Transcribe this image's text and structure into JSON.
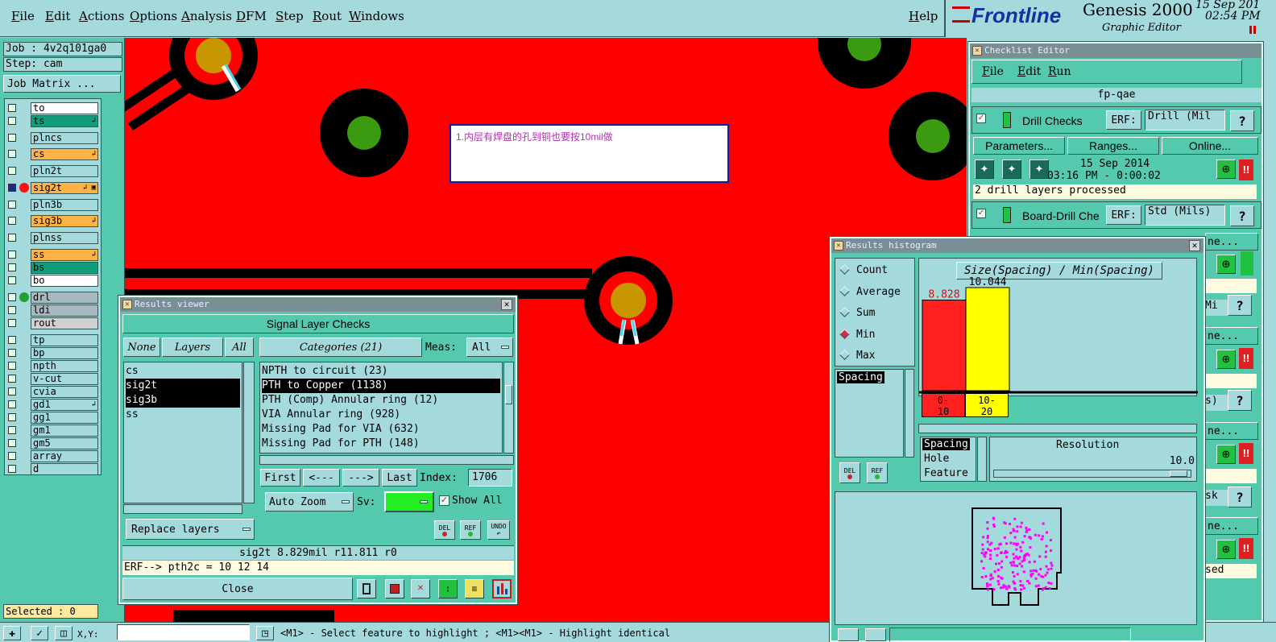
{
  "menu": {
    "items": [
      "File",
      "Edit",
      "Actions",
      "Options",
      "Analysis",
      "DFM",
      "Step",
      "Rout",
      "Windows"
    ],
    "help": "Help",
    "brand": "Frontline",
    "product": "Genesis 2000",
    "subtitle": "Graphic Editor",
    "date": "15 Sep 201",
    "time": "02:54 PM"
  },
  "left": {
    "job": "Job : 4v2q101ga0",
    "step": "Step: cam",
    "job_matrix": "Job Matrix ...",
    "selected": "Selected : 0",
    "xy_label": "X,Y:"
  },
  "layers": [
    {
      "name": "to",
      "color": "#ffffff",
      "flag": ""
    },
    {
      "name": "ts",
      "color": "#119c7b",
      "flag": "↲"
    },
    {
      "name": "plncs",
      "color": "#a4dadb",
      "flag": ""
    },
    {
      "name": "cs",
      "color": "#ffb347",
      "flag": "↲"
    },
    {
      "name": "pln2t",
      "color": "#a4dadb",
      "flag": ""
    },
    {
      "name": "sig2t",
      "color": "#ffb347",
      "flag": "↲ ▣"
    },
    {
      "name": "pln3b",
      "color": "#a4dadb",
      "flag": ""
    },
    {
      "name": "sig3b",
      "color": "#ffb347",
      "flag": "↲"
    },
    {
      "name": "plnss",
      "color": "#a4dadb",
      "flag": ""
    },
    {
      "name": "ss",
      "color": "#ffb347",
      "flag": "↲"
    },
    {
      "name": "bs",
      "color": "#119c7b",
      "flag": ""
    },
    {
      "name": "bo",
      "color": "#ffffff",
      "flag": ""
    },
    {
      "name": "drl",
      "color": "#a8b8c0",
      "flag": ""
    },
    {
      "name": "ldi",
      "color": "#a8b8c0",
      "flag": ""
    },
    {
      "name": "rout",
      "color": "#d0d0d0",
      "flag": ""
    },
    {
      "name": "tp",
      "color": "#a4dadb",
      "flag": ""
    },
    {
      "name": "bp",
      "color": "#a4dadb",
      "flag": ""
    },
    {
      "name": "npth",
      "color": "#a4dadb",
      "flag": ""
    },
    {
      "name": "v-cut",
      "color": "#a4dadb",
      "flag": ""
    },
    {
      "name": "cvia",
      "color": "#a4dadb",
      "flag": ""
    },
    {
      "name": "gd1",
      "color": "#a4dadb",
      "flag": "↲"
    },
    {
      "name": "gg1",
      "color": "#a4dadb",
      "flag": ""
    },
    {
      "name": "gm1",
      "color": "#a4dadb",
      "flag": ""
    },
    {
      "name": "gm5",
      "color": "#a4dadb",
      "flag": ""
    },
    {
      "name": "array",
      "color": "#a4dadb",
      "flag": ""
    },
    {
      "name": "d",
      "color": "#a4dadb",
      "flag": ""
    }
  ],
  "canvas": {
    "note": "1.内层有焊盘的孔到铜也要按10mil做"
  },
  "results_viewer": {
    "title": "Results viewer",
    "header": "Signal Layer Checks",
    "none_btn": "None",
    "layers_btn": "Layers",
    "all_btn": "All",
    "categories_btn": "Categories (21)",
    "meas_label": "Meas:",
    "meas_value": "All",
    "layer_list": [
      "cs",
      "sig2t",
      "sig3b",
      "ss"
    ],
    "categories": [
      "NPTH to circuit (23)",
      "PTH to Copper (1138)",
      "PTH (Comp) Annular ring (12)",
      "VIA Annular ring (928)",
      "Missing Pad for VIA (632)",
      "Missing Pad for PTH (148)"
    ],
    "first": "First",
    "prev": "<---",
    "next": "--->",
    "last": "Last",
    "index_label": "Index:",
    "index_value": "1706",
    "auto_zoom": "Auto Zoom",
    "sv_label": "Sv:",
    "show_all": "Show All",
    "replace_layers": "Replace layers",
    "del": "DEL",
    "ref": "REF",
    "undo": "UNDO",
    "status": "sig2t 8.829mil  r11.811  r0",
    "erf": "ERF--> pth2c = 10 12 14",
    "close": "Close"
  },
  "checklist": {
    "title": "Checklist Editor",
    "menu": [
      "File",
      "Edit",
      "Run"
    ],
    "name": "fp-qae",
    "check1": {
      "label": "Drill Checks",
      "erf_label": "ERF:",
      "erf_value": "Drill (Mil",
      "date": "15 Sep 2014",
      "time": "03:16 PM - 0:00:02",
      "status": "2 drill layers processed"
    },
    "buttons": [
      "Parameters...",
      "Ranges...",
      "Online..."
    ],
    "check2": {
      "label": "Board-Drill Che",
      "erf_label": "ERF:",
      "erf_value": "Std (Mils)"
    },
    "help": "?",
    "right_fragments": [
      "ne...",
      "Mi",
      "ne...",
      "s)",
      "ne...",
      "sk",
      "ne...",
      "sed"
    ]
  },
  "histogram": {
    "title": "Results histogram",
    "modes": [
      "Count",
      "Average",
      "Sum",
      "Min",
      "Max"
    ],
    "selected_mode": "Min",
    "measure": "Spacing",
    "chart_title": "Size(Spacing) / Min(Spacing)",
    "resolution_label": "Resolution",
    "resolution_value": "10.0",
    "attr_list": [
      "Spacing",
      "Hole",
      "Feature"
    ],
    "del": "DEL",
    "ref": "REF"
  },
  "chart_data": {
    "type": "bar",
    "title": "Size(Spacing) / Min(Spacing)",
    "categories": [
      "0-10",
      "10-20"
    ],
    "values": [
      8.828,
      10.044
    ],
    "colors": [
      "#ff2020",
      "#ffff00"
    ],
    "ylim": [
      0,
      10.044
    ]
  },
  "statusbar": {
    "hint": "<M1> - Select feature to highlight ; <M1><M1> - Highlight identical"
  },
  "colors": {
    "copper": "#ff0000",
    "pad": "#c89600",
    "drill": "#3a9a10",
    "clearance": "#000000",
    "panel": "#55c9ad",
    "bg": "#a4dadb"
  }
}
